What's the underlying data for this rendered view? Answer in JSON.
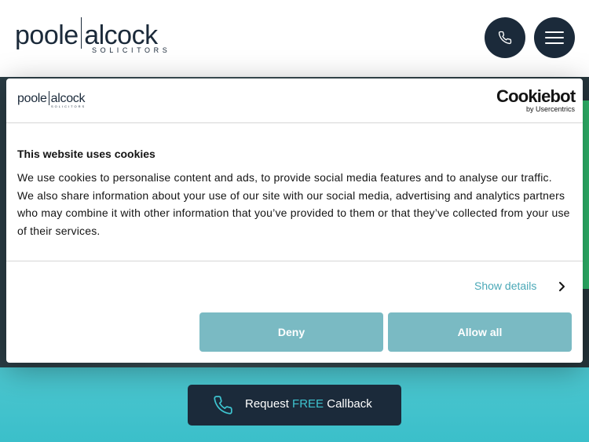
{
  "header": {
    "logo_left": "poole",
    "logo_right": "alcock",
    "logo_sub": "SOLICITORS",
    "phone_icon": "phone-icon",
    "menu_icon": "hamburger-icon"
  },
  "cookie": {
    "logo_left": "poole",
    "logo_right": "alcock",
    "logo_sub": "SOLICITORS",
    "brand": "Cookiebot",
    "brand_sub": "by Usercentrics",
    "title": "This website uses cookies",
    "body": "We use cookies to personalise content and ads, to provide social media features and to analyse our traffic. We also share information about your use of our site with our social media, advertising and analytics partners who may combine it with other information that you’ve provided to them or that they’ve collected from your use of their services.",
    "show_details": "Show details",
    "deny": "Deny",
    "allow_all": "Allow all"
  },
  "cta": {
    "label_before": "Request ",
    "label_free": "FREE",
    "label_after": " Callback",
    "icon": "phone-icon"
  },
  "colors": {
    "navy": "#1b2a3a",
    "teal": "#3ec3cf",
    "button": "#7abac3",
    "link": "#4aa8b7"
  }
}
